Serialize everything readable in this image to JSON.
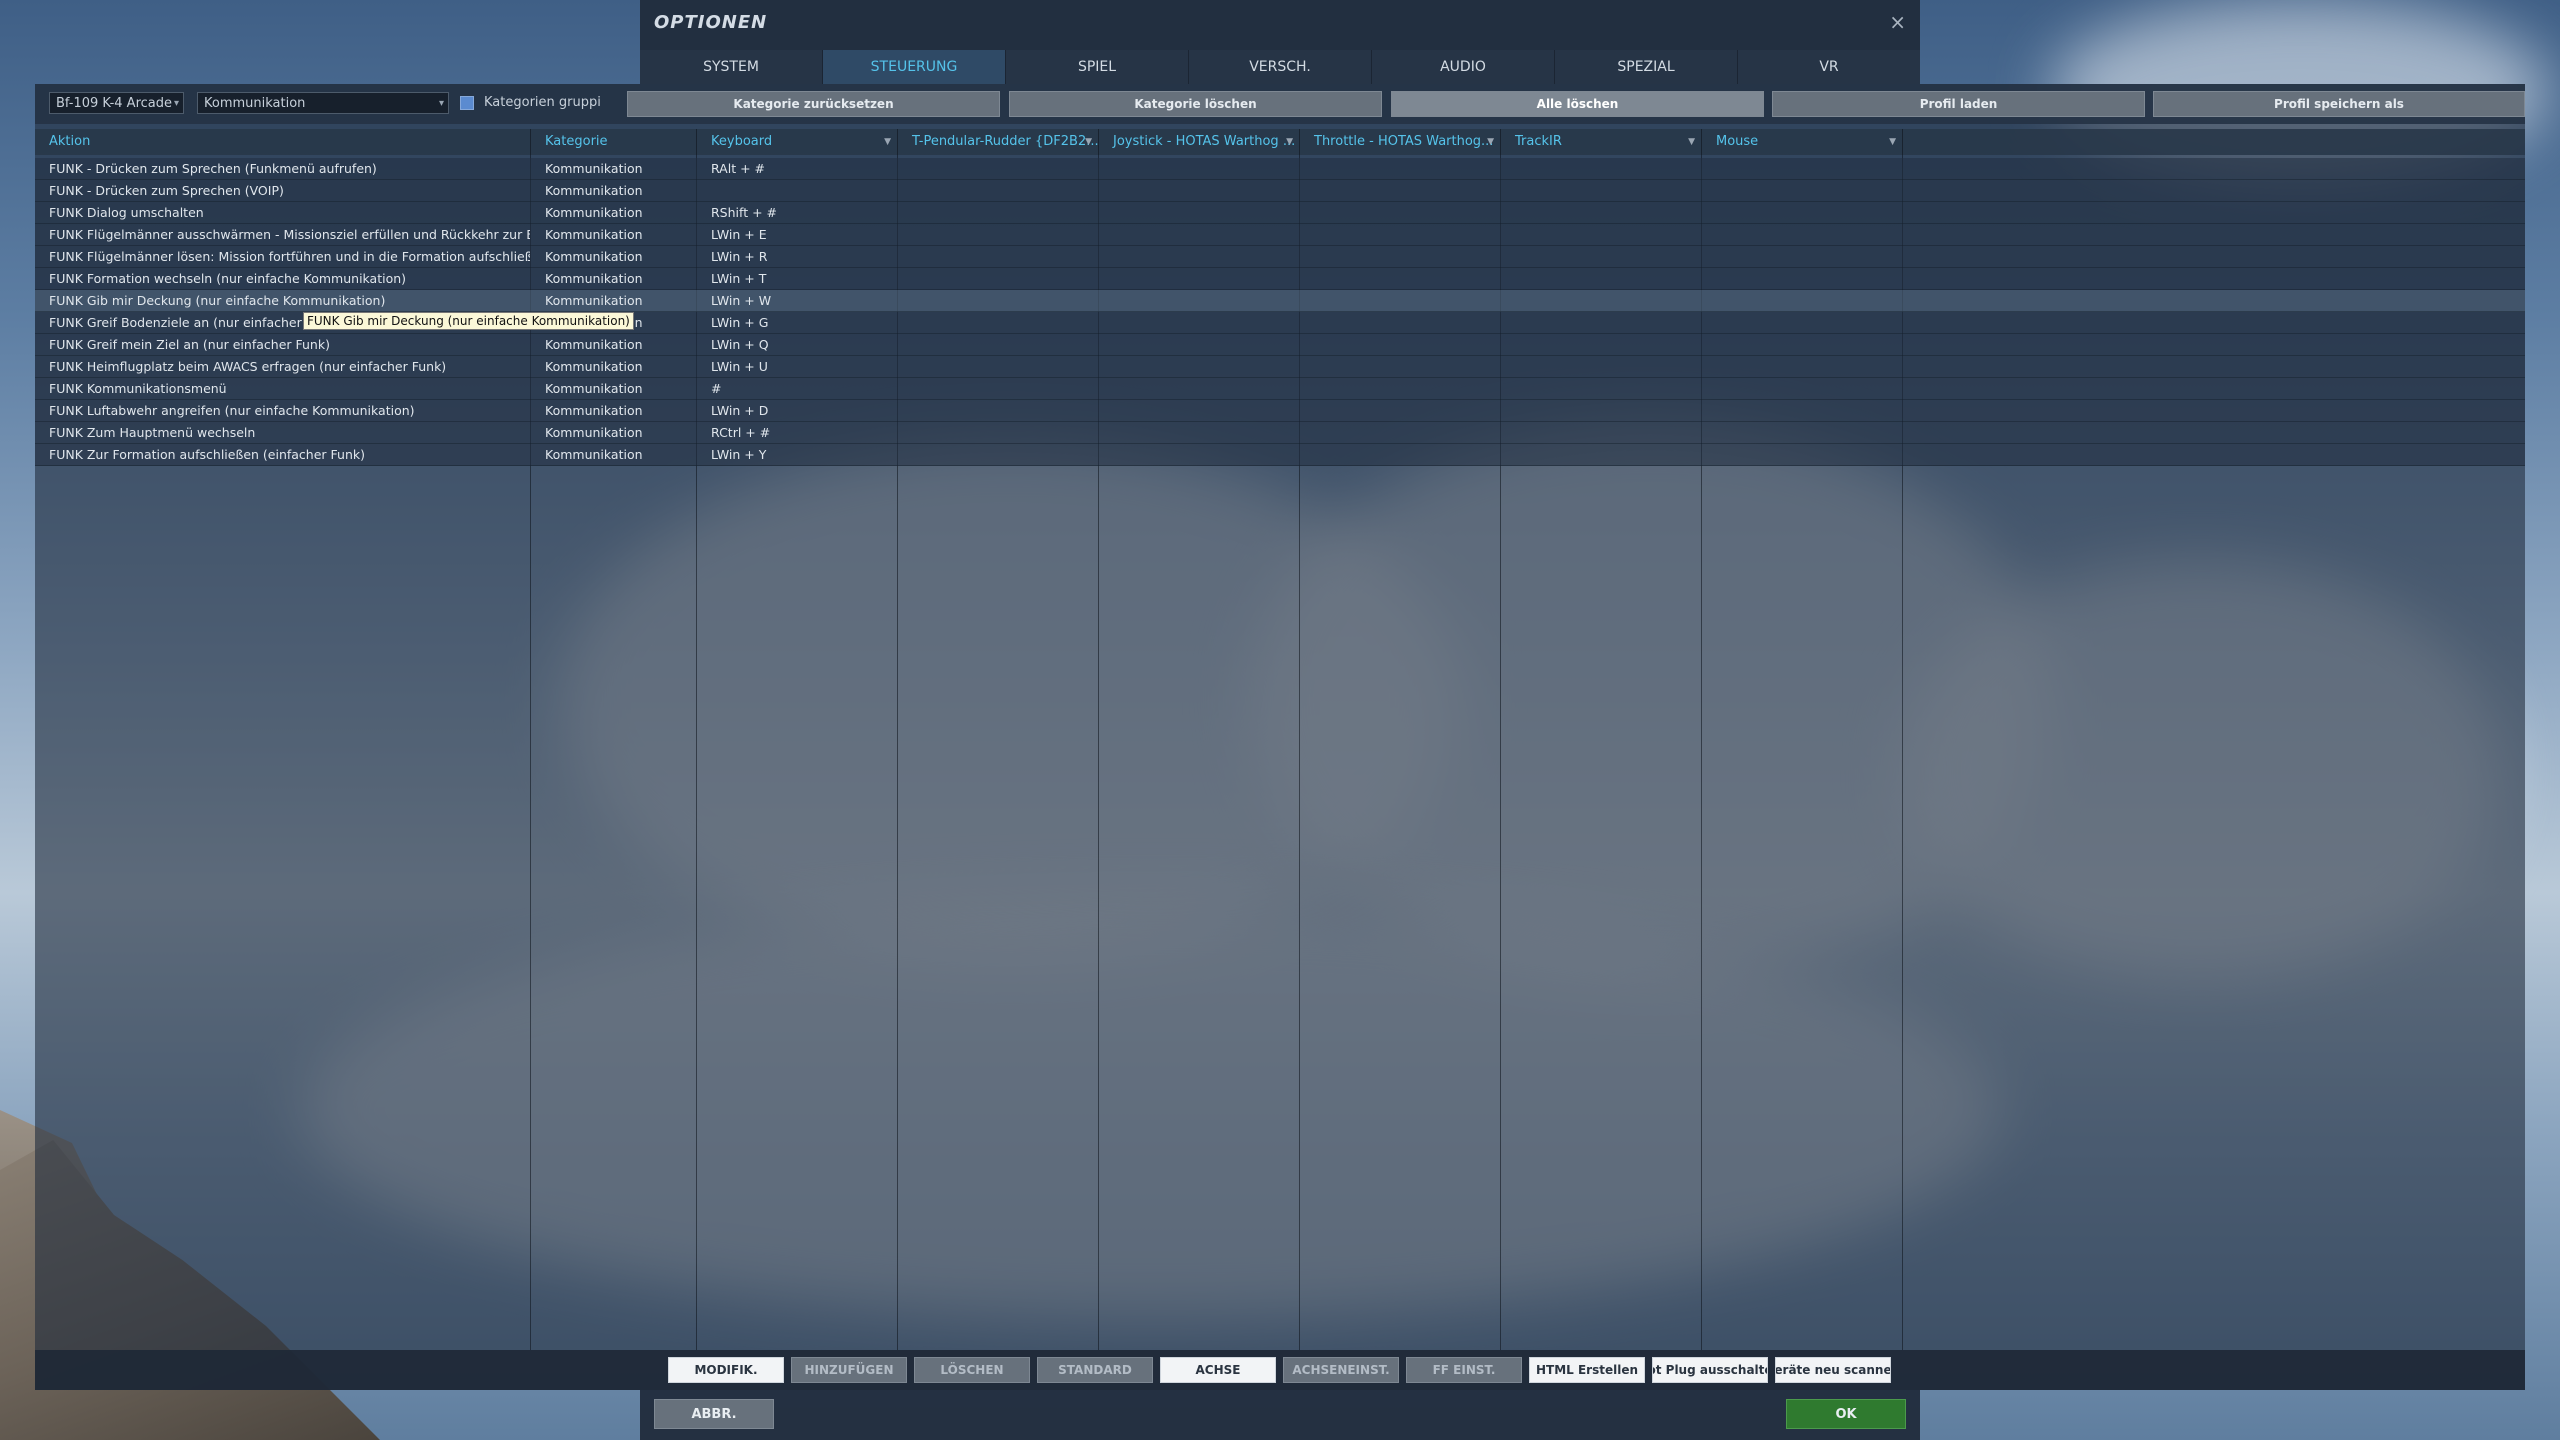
{
  "window": {
    "title": "OPTIONEN",
    "close_icon": "×"
  },
  "tabs": [
    {
      "label": "SYSTEM"
    },
    {
      "label": "STEUERUNG",
      "active": true
    },
    {
      "label": "SPIEL"
    },
    {
      "label": "VERSCH."
    },
    {
      "label": "AUDIO"
    },
    {
      "label": "SPEZIAL"
    },
    {
      "label": "VR"
    }
  ],
  "toolbar": {
    "aircraft_select": "Bf-109 K-4 Arcade",
    "category_select": "Kommunikation",
    "group_categories_label": "Kategorien gruppi",
    "buttons": [
      "Kategorie zurücksetzen",
      "Kategorie löschen",
      "Alle löschen",
      "Profil laden",
      "Profil speichern als"
    ]
  },
  "columns": [
    "Aktion",
    "Kategorie",
    "Keyboard",
    "T-Pendular-Rudder {DF2B2...",
    "Joystick - HOTAS Warthog ...",
    "Throttle - HOTAS Warthog...",
    "TrackIR",
    "Mouse"
  ],
  "rows": [
    {
      "aktion": "FUNK - Drücken zum Sprechen (Funkmenü aufrufen)",
      "kategorie": "Kommunikation",
      "keyboard": "RAlt + #"
    },
    {
      "aktion": "FUNK - Drücken zum Sprechen (VOIP)",
      "kategorie": "Kommunikation",
      "keyboard": ""
    },
    {
      "aktion": "FUNK Dialog umschalten",
      "kategorie": "Kommunikation",
      "keyboard": "RShift + #"
    },
    {
      "aktion": "FUNK Flügelmänner ausschwärmen - Missionsziel erfüllen und Rückkehr zur Basis (",
      "kategorie": "Kommunikation",
      "keyboard": "LWin + E"
    },
    {
      "aktion": "FUNK Flügelmänner lösen: Mission fortführen und in die Formation aufschließen  (n",
      "kategorie": "Kommunikation",
      "keyboard": "LWin + R"
    },
    {
      "aktion": "FUNK Formation wechseln (nur einfache Kommunikation)",
      "kategorie": "Kommunikation",
      "keyboard": "LWin + T"
    },
    {
      "aktion": "FUNK Gib mir Deckung (nur einfache Kommunikation)",
      "kategorie": "Kommunikation",
      "keyboard": "LWin + W",
      "highlighted": true
    },
    {
      "aktion": "FUNK Greif Bodenziele an (nur einfacher Fu",
      "kategorie": "Kommunikation",
      "keyboard": "LWin + G"
    },
    {
      "aktion": "FUNK Greif mein Ziel an (nur einfacher Funk)",
      "kategorie": "Kommunikation",
      "keyboard": "LWin + Q"
    },
    {
      "aktion": "FUNK Heimflugplatz beim AWACS erfragen (nur einfacher Funk)",
      "kategorie": "Kommunikation",
      "keyboard": "LWin + U"
    },
    {
      "aktion": "FUNK Kommunikationsmenü",
      "kategorie": "Kommunikation",
      "keyboard": "#"
    },
    {
      "aktion": "FUNK Luftabwehr angreifen (nur einfache Kommunikation)",
      "kategorie": "Kommunikation",
      "keyboard": "LWin + D"
    },
    {
      "aktion": "FUNK Zum Hauptmenü wechseln",
      "kategorie": "Kommunikation",
      "keyboard": "RCtrl + #"
    },
    {
      "aktion": "FUNK Zur Formation aufschließen (einfacher Funk)",
      "kategorie": "Kommunikation",
      "keyboard": "LWin + Y"
    }
  ],
  "tooltip": "FUNK Gib mir Deckung (nur einfache Kommunikation)",
  "bottom_buttons": [
    "MODIFIK.",
    "HINZUFÜGEN",
    "LÖSCHEN",
    "STANDARD",
    "ACHSE",
    "ACHSENEINST.",
    "FF EINST.",
    "HTML Erstellen",
    "ot Plug ausschalte",
    "eräte neu scanne"
  ],
  "footer": {
    "cancel": "ABBR.",
    "ok": "OK"
  }
}
